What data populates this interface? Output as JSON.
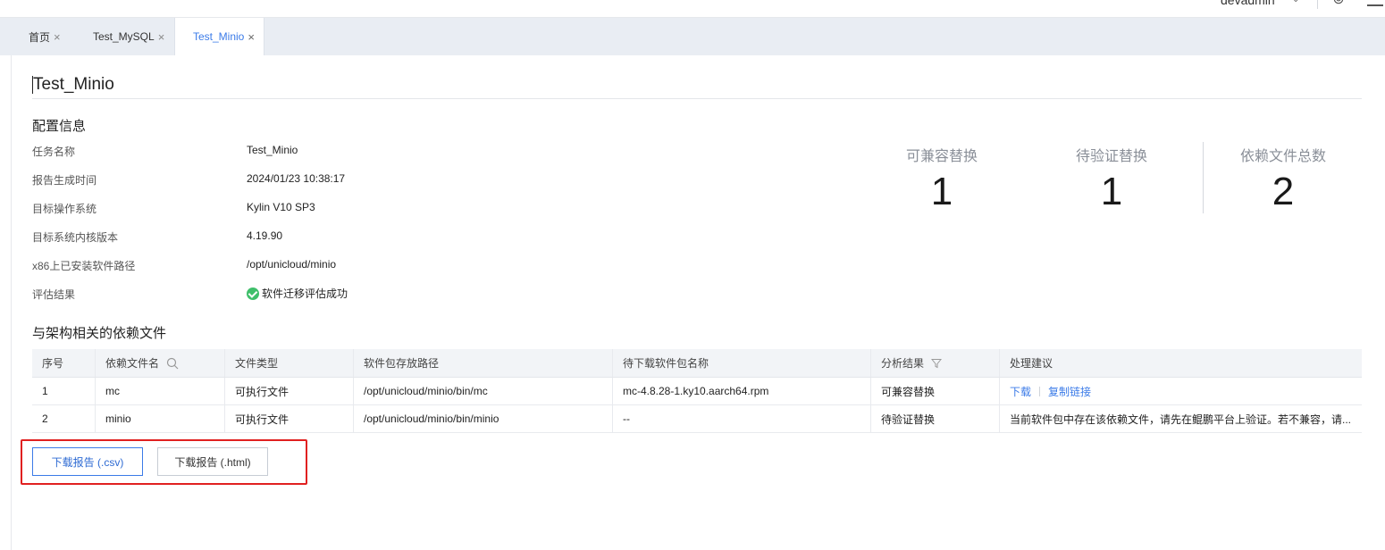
{
  "header": {
    "username": "devadmin"
  },
  "tabs": [
    {
      "label": "首页",
      "active": false
    },
    {
      "label": "Test_MySQL",
      "active": false
    },
    {
      "label": "Test_Minio",
      "active": true
    }
  ],
  "page": {
    "title": "Test_Minio"
  },
  "config": {
    "heading": "配置信息",
    "rows": [
      {
        "label": "任务名称",
        "value": "Test_Minio"
      },
      {
        "label": "报告生成时间",
        "value": "2024/01/23 10:38:17"
      },
      {
        "label": "目标操作系统",
        "value": "Kylin V10 SP3"
      },
      {
        "label": "目标系统内核版本",
        "value": "4.19.90"
      },
      {
        "label": "x86上已安装软件路径",
        "value": "/opt/unicloud/minio"
      },
      {
        "label": "评估结果",
        "value": "软件迁移评估成功"
      }
    ]
  },
  "stats": [
    {
      "label": "可兼容替换",
      "value": "1"
    },
    {
      "label": "待验证替换",
      "value": "1"
    },
    {
      "label": "依赖文件总数",
      "value": "2"
    }
  ],
  "deps": {
    "heading": "与架构相关的依赖文件",
    "columns": [
      "序号",
      "依赖文件名",
      "文件类型",
      "软件包存放路径",
      "待下载软件包名称",
      "分析结果",
      "处理建议"
    ],
    "rows": [
      {
        "index": "1",
        "name": "mc",
        "type": "可执行文件",
        "path": "/opt/unicloud/minio/bin/mc",
        "package": "mc-4.8.28-1.ky10.aarch64.rpm",
        "result": "可兼容替换",
        "download_label": "下载",
        "copy_label": "复制链接"
      },
      {
        "index": "2",
        "name": "minio",
        "type": "可执行文件",
        "path": "/opt/unicloud/minio/bin/minio",
        "package": "--",
        "result": "待验证替换",
        "advice": "当前软件包中存在该依赖文件，请先在鲲鹏平台上验证。若不兼容，请..."
      }
    ]
  },
  "buttons": {
    "csv": "下载报告 (.csv)",
    "html": "下载报告 (.html)"
  },
  "colors": {
    "accent": "#3b7be8",
    "success": "#3fbf6a",
    "highlight": "#e02020"
  }
}
